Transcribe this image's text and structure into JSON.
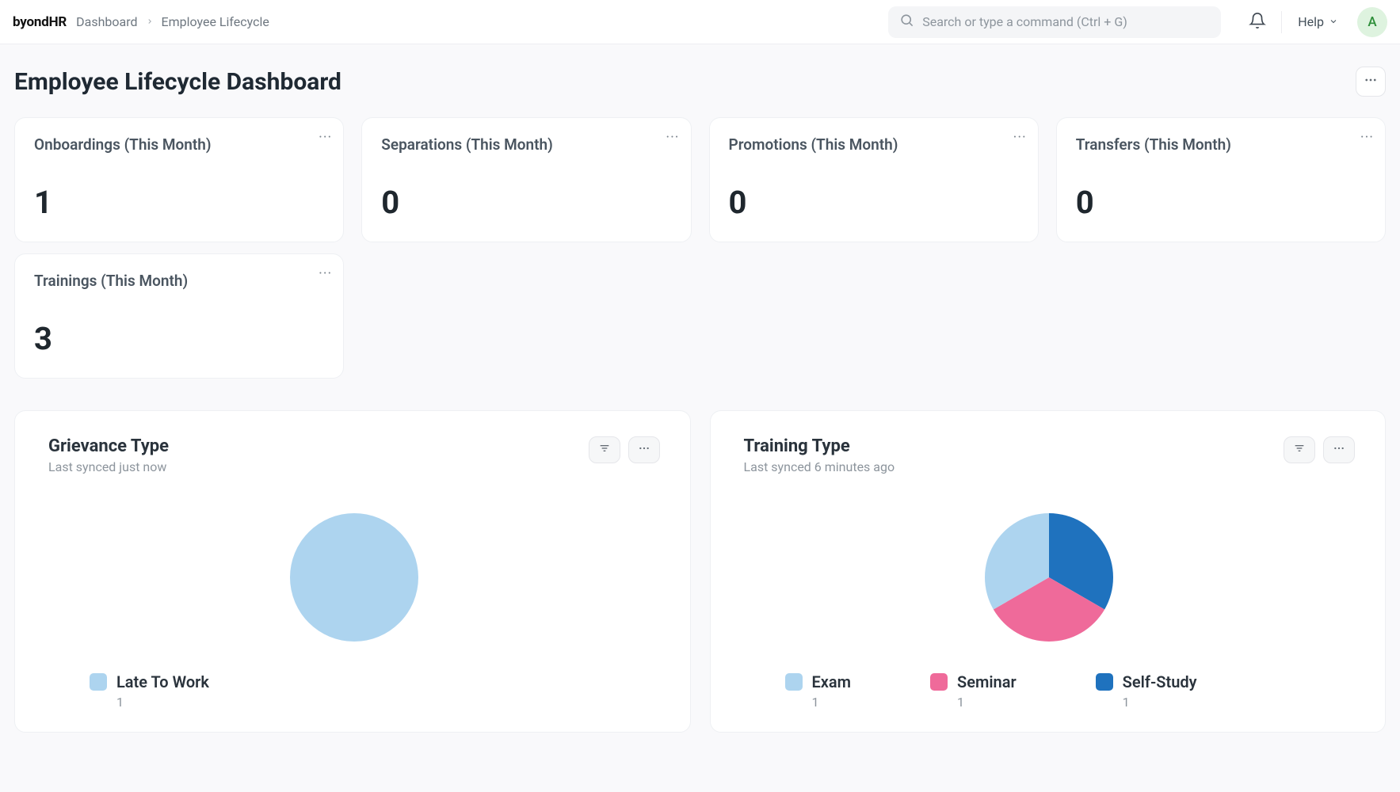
{
  "brand": {
    "name": "byondHR"
  },
  "breadcrumb": [
    "Dashboard",
    "Employee Lifecycle"
  ],
  "search_placeholder": "Search or type a command (Ctrl + G)",
  "help_label": "Help",
  "avatar_initial": "A",
  "page_title": "Employee Lifecycle Dashboard",
  "stat_cards": [
    {
      "title": "Onboardings (This Month)",
      "value": "1"
    },
    {
      "title": "Separations (This Month)",
      "value": "0"
    },
    {
      "title": "Promotions (This Month)",
      "value": "0"
    },
    {
      "title": "Transfers (This Month)",
      "value": "0"
    },
    {
      "title": "Trainings (This Month)",
      "value": "3"
    }
  ],
  "panels": {
    "grievance": {
      "title": "Grievance Type",
      "synced": "Last synced just now",
      "legend": [
        {
          "label": "Late To Work",
          "value": "1",
          "color": "#add4ef"
        }
      ]
    },
    "training": {
      "title": "Training Type",
      "synced": "Last synced 6 minutes ago",
      "legend": [
        {
          "label": "Exam",
          "value": "1",
          "color": "#add4ef"
        },
        {
          "label": "Seminar",
          "value": "1",
          "color": "#ef6a9a"
        },
        {
          "label": "Self-Study",
          "value": "1",
          "color": "#1f72be"
        }
      ]
    }
  },
  "colors": {
    "lightblue": "#add4ef",
    "pink": "#ef6a9a",
    "blue": "#1f72be"
  },
  "chart_data": [
    {
      "type": "pie",
      "title": "Grievance Type",
      "series": [
        {
          "name": "Late To Work",
          "values": [
            1
          ]
        }
      ],
      "categories": [
        "Late To Work"
      ]
    },
    {
      "type": "pie",
      "title": "Training Type",
      "series": [
        {
          "name": "Exam",
          "values": [
            1
          ]
        },
        {
          "name": "Seminar",
          "values": [
            1
          ]
        },
        {
          "name": "Self-Study",
          "values": [
            1
          ]
        }
      ],
      "categories": [
        "Exam",
        "Seminar",
        "Self-Study"
      ]
    }
  ]
}
